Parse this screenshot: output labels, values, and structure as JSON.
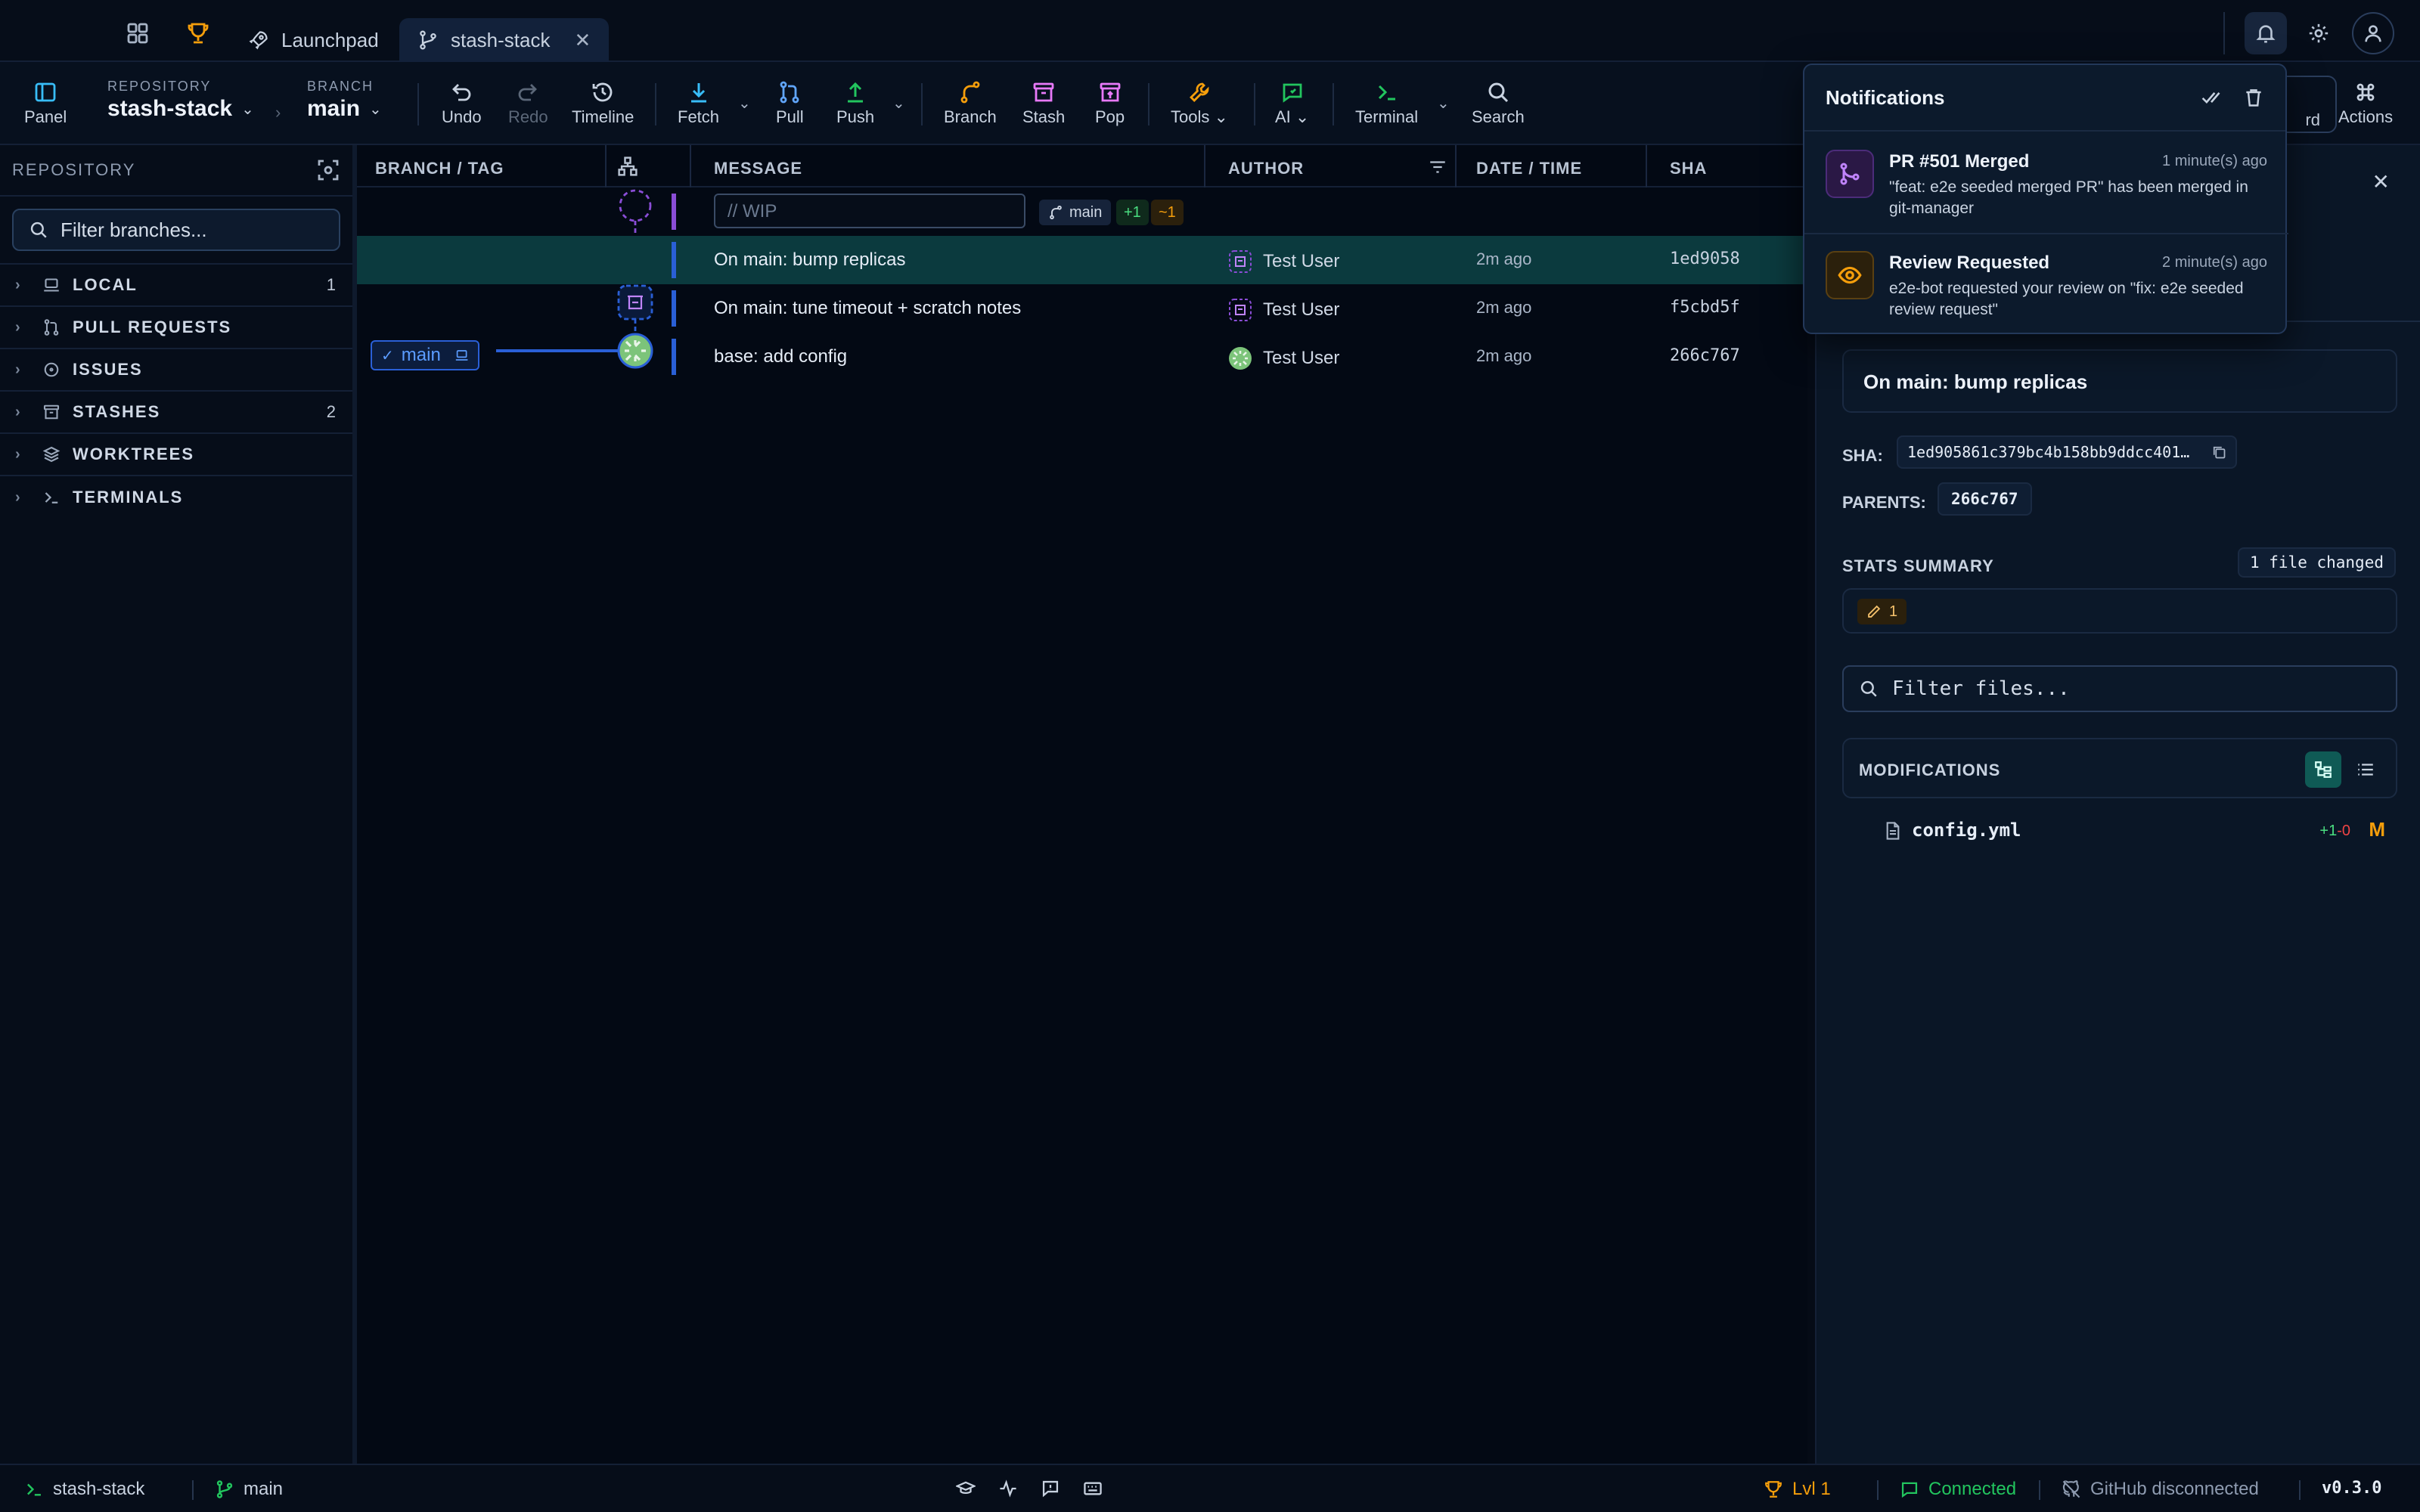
{
  "titlebar": {
    "tabs": [
      {
        "label": "Launchpad",
        "icon": "rocket-icon"
      },
      {
        "label": "stash-stack",
        "icon": "branch-icon",
        "active": true
      }
    ]
  },
  "toolbar": {
    "panel": "Panel",
    "repository_label": "REPOSITORY",
    "repository_name": "stash-stack",
    "branch_label": "BRANCH",
    "branch_name": "main",
    "undo": "Undo",
    "redo": "Redo",
    "timeline": "Timeline",
    "fetch": "Fetch",
    "pull": "Pull",
    "push": "Push",
    "branch": "Branch",
    "stash": "Stash",
    "pop": "Pop",
    "tools": "Tools",
    "ai": "AI",
    "terminal": "Terminal",
    "search": "Search",
    "actions": "Actions",
    "obscured_label": "rd"
  },
  "left": {
    "title": "REPOSITORY",
    "filter_placeholder": "Filter branches...",
    "sections": [
      {
        "label": "LOCAL",
        "count": "1"
      },
      {
        "label": "PULL REQUESTS",
        "count": ""
      },
      {
        "label": "ISSUES",
        "count": ""
      },
      {
        "label": "STASHES",
        "count": "2"
      },
      {
        "label": "WORKTREES",
        "count": ""
      },
      {
        "label": "TERMINALS",
        "count": ""
      }
    ]
  },
  "graph": {
    "headers": {
      "branch_tag": "BRANCH / TAG",
      "message": "MESSAGE",
      "author": "AUTHOR",
      "date": "DATE / TIME",
      "sha": "SHA"
    },
    "wip": {
      "placeholder": "// WIP",
      "branch": "main",
      "added": "+1",
      "modified": "~1"
    },
    "branch_chip": "main",
    "rows": [
      {
        "message": "On main: bump replicas",
        "author": "Test User",
        "date": "2m ago",
        "sha": "1ed9058"
      },
      {
        "message": "On main: tune timeout + scratch notes",
        "author": "Test User",
        "date": "2m ago",
        "sha": "f5cbd5f"
      },
      {
        "message": "base: add config",
        "author": "Test User",
        "date": "2m ago",
        "sha": "266c767"
      }
    ]
  },
  "detail": {
    "commit_title": "On main: bump replicas",
    "sha_label": "SHA:",
    "sha_value": "1ed905861c379bc4b158bb9ddcc401…",
    "parents_label": "PARENTS:",
    "parent_value": "266c767",
    "stats_label": "STATS SUMMARY",
    "files_changed": "1 file changed",
    "modified_count": "1",
    "filter_placeholder": "Filter files...",
    "modifications_label": "MODIFICATIONS",
    "file": {
      "name": "config.yml",
      "added": "+1",
      "removed": "-0",
      "status": "M"
    }
  },
  "notifications": {
    "title": "Notifications",
    "items": [
      {
        "title": "PR #501 Merged",
        "time": "1 minute(s) ago",
        "body": "\"feat: e2e seeded merged PR\" has been merged in git-manager"
      },
      {
        "title": "Review Requested",
        "time": "2 minute(s) ago",
        "body": "e2e-bot requested your review on \"fix: e2e seeded review request\""
      }
    ]
  },
  "status": {
    "repo": "stash-stack",
    "branch": "main",
    "level": "Lvl 1",
    "connected": "Connected",
    "github": "GitHub disconnected",
    "version": "v0.3.0"
  },
  "colors": {
    "accent_teal": "#0b3a3e",
    "lane_blue": "#2a5fd6",
    "wip_purple": "#8a4dd6",
    "trophy_orange": "#f59e0b",
    "connected_green": "#22c55e"
  }
}
